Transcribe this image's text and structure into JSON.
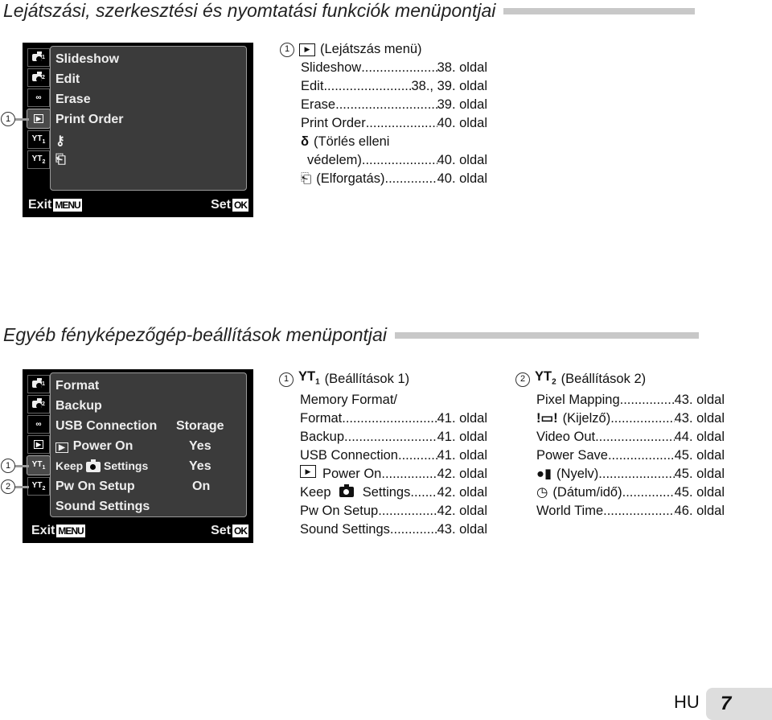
{
  "section1": {
    "heading": "Lejátszási, szerkesztési és nyomtatási funkciók menüpontjai",
    "screen": {
      "tabs": [
        "1",
        "2",
        "movie",
        "play",
        "T1",
        "T2"
      ],
      "items": [
        "Slideshow",
        "Edit",
        "Erase",
        "Print Order",
        "⚷",
        "⎗"
      ],
      "exit_label": "Exit",
      "menu_badge": "MENU",
      "set_label": "Set",
      "ok_badge": "OK",
      "callout": "1"
    },
    "list": {
      "callout": "1",
      "header": "(Lejátszás menü)",
      "rows": [
        {
          "label": "Slideshow",
          "page": "38. oldal"
        },
        {
          "label": "Edit",
          "page": "38., 39. oldal"
        },
        {
          "label": "Erase",
          "page": "39. oldal"
        },
        {
          "label": "Print Order",
          "page": "40. oldal"
        },
        {
          "label": "(Törlés elleni",
          "page": ""
        },
        {
          "label": "védelem)",
          "page": "40. oldal"
        },
        {
          "label": "(Elforgatás)",
          "page": "40. oldal"
        }
      ]
    }
  },
  "section2": {
    "heading": "Egyéb fényképezőgép-beállítások menüpontjai",
    "screen": {
      "items": [
        {
          "label": "Format",
          "value": ""
        },
        {
          "label": "Backup",
          "value": ""
        },
        {
          "label": "USB Connection",
          "value": "Storage"
        },
        {
          "label": "Power On",
          "value": "Yes"
        },
        {
          "label": "Keep",
          "label2": "Settings",
          "value": "Yes"
        },
        {
          "label": "Pw On Setup",
          "value": "On"
        },
        {
          "label": "Sound Settings",
          "value": ""
        }
      ],
      "exit_label": "Exit",
      "menu_badge": "MENU",
      "set_label": "Set",
      "ok_badge": "OK",
      "callout1": "1",
      "callout2": "2"
    },
    "list1": {
      "callout": "1",
      "header": "(Beállítások 1)",
      "rows": [
        {
          "label": "Memory Format/",
          "page": ""
        },
        {
          "label": "Format",
          "page": "41. oldal"
        },
        {
          "label": "Backup",
          "page": "41. oldal"
        },
        {
          "label": "USB Connection",
          "page": "41. oldal"
        },
        {
          "label": "Power On",
          "page": "42. oldal"
        },
        {
          "label": "Keep",
          "label2": "Settings",
          "page": "42. oldal"
        },
        {
          "label": "Pw On Setup",
          "page": "42. oldal"
        },
        {
          "label": "Sound Settings",
          "page": "43. oldal"
        }
      ]
    },
    "list2": {
      "callout": "2",
      "header": "(Beállítások 2)",
      "rows": [
        {
          "label": "Pixel Mapping",
          "page": "43. oldal"
        },
        {
          "label": "(Kijelző)",
          "page": "43. oldal"
        },
        {
          "label": "Video Out",
          "page": "44. oldal"
        },
        {
          "label": "Power Save",
          "page": "45. oldal"
        },
        {
          "label": "(Nyelv)",
          "page": "45. oldal"
        },
        {
          "label": "(Dátum/idő)",
          "page": "45. oldal"
        },
        {
          "label": "World Time",
          "page": "46. oldal"
        }
      ]
    }
  },
  "footer": {
    "lang": "HU",
    "page": "7"
  }
}
